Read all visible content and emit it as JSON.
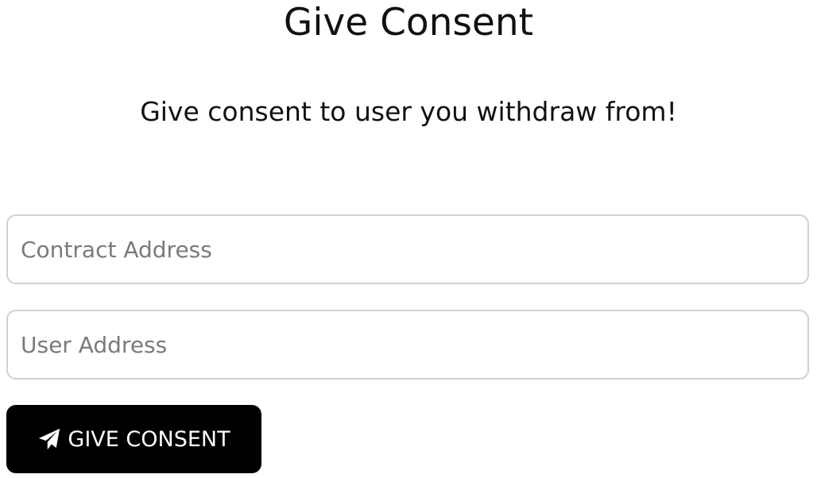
{
  "page": {
    "title": "Give Consent",
    "subtitle": "Give consent to user you withdraw from!"
  },
  "form": {
    "contract_address": {
      "value": "",
      "placeholder": "Contract Address"
    },
    "user_address": {
      "value": "",
      "placeholder": "User Address"
    },
    "submit": {
      "label": "GIVE CONSENT",
      "icon": "paper-plane-icon"
    }
  },
  "colors": {
    "button_background": "#000000",
    "button_text": "#ffffff",
    "field_border": "#d2d2d2",
    "placeholder": "#7a7a7a"
  }
}
